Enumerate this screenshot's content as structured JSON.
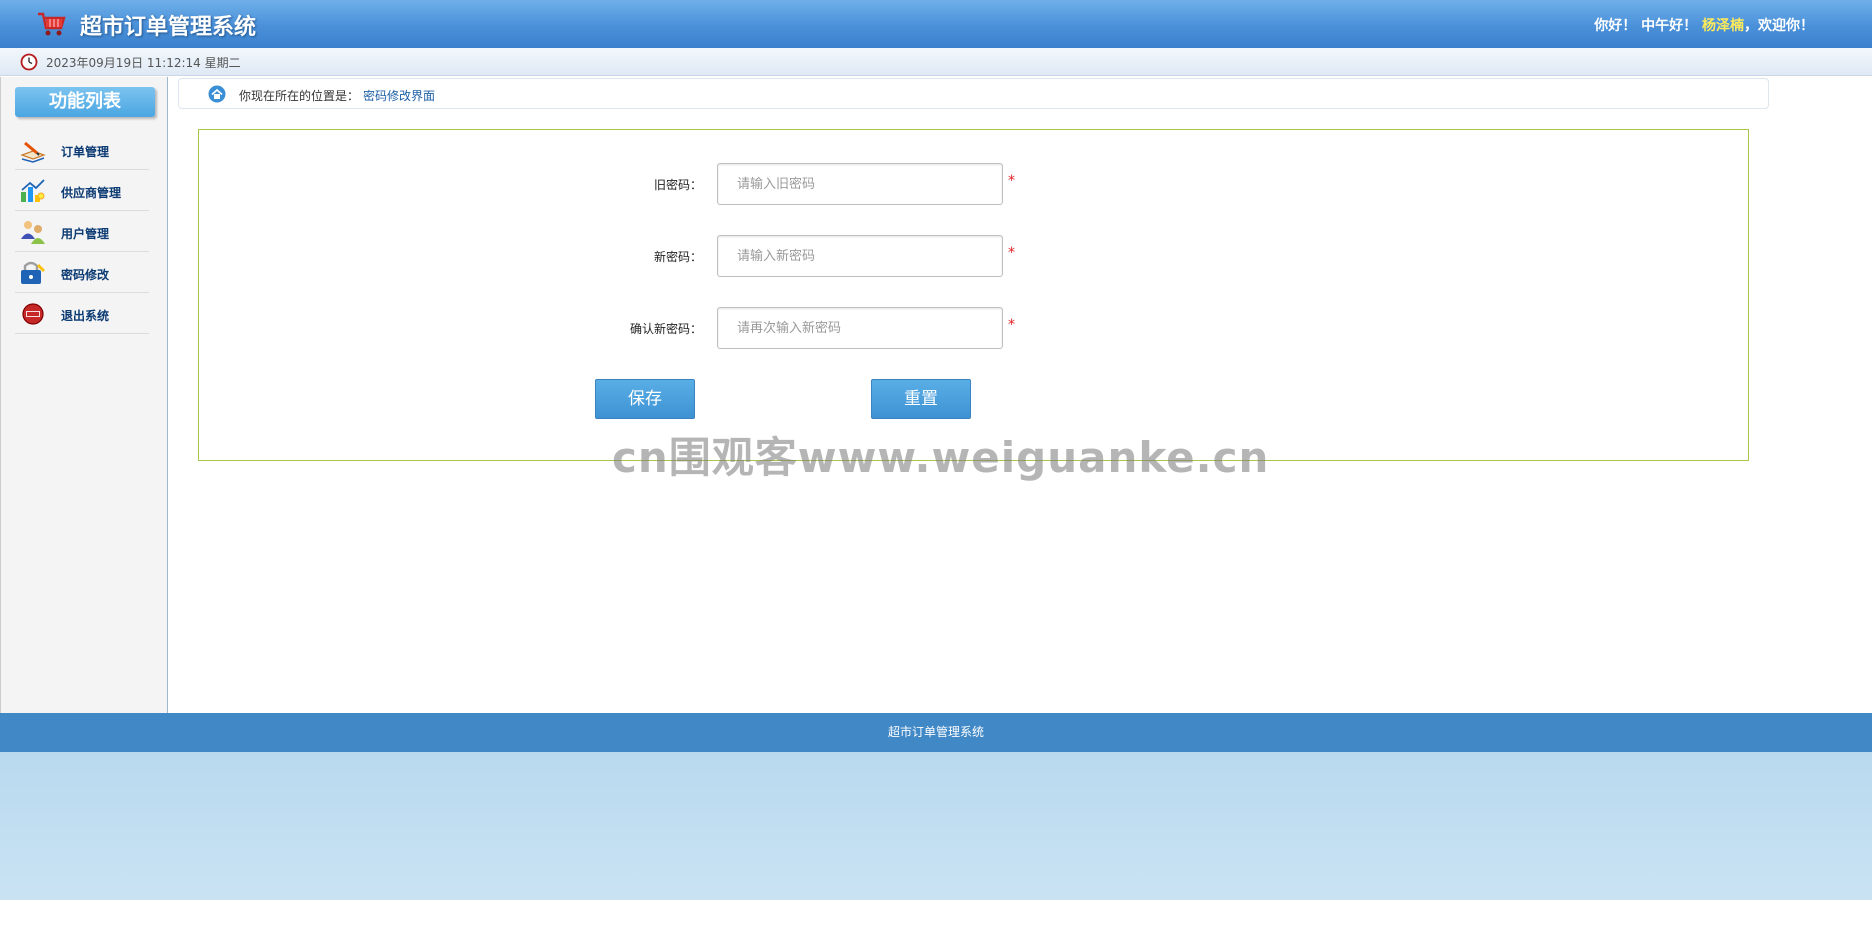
{
  "header": {
    "app_title": "超市订单管理系统",
    "greeting_prefix": "你好！ 中午好！ ",
    "username": "杨泽楠",
    "greeting_suffix": "，欢迎你！"
  },
  "timebar": {
    "datetime": "2023年09月19日 11:12:14 星期二"
  },
  "sidebar": {
    "title": "功能列表",
    "items": [
      {
        "label": "订单管理",
        "icon": "order-book-icon"
      },
      {
        "label": "供应商管理",
        "icon": "supplier-chart-icon"
      },
      {
        "label": "用户管理",
        "icon": "users-icon"
      },
      {
        "label": "密码修改",
        "icon": "lock-icon"
      },
      {
        "label": "退出系统",
        "icon": "exit-icon"
      }
    ]
  },
  "location": {
    "label": "你现在所在的位置是：",
    "current": "密码修改界面"
  },
  "form": {
    "old_password": {
      "label": "旧密码：",
      "placeholder": "请输入旧密码",
      "required": "*"
    },
    "new_password": {
      "label": "新密码：",
      "placeholder": "请输入新密码",
      "required": "*"
    },
    "confirm_password": {
      "label": "确认新密码：",
      "placeholder": "请再次输入新密码",
      "required": "*"
    },
    "save_label": "保存",
    "reset_label": "重置"
  },
  "footer": {
    "text": "超市订单管理系统"
  },
  "watermark": "cn围观客www.weiguanke.cn",
  "colors": {
    "header_blue": "#4a90d9",
    "footer_blue": "#4088c6",
    "accent_button": "#3e92d2",
    "panel_border": "#a7c64a",
    "required_red": "#e02020",
    "username_yellow": "#ffea5a"
  }
}
